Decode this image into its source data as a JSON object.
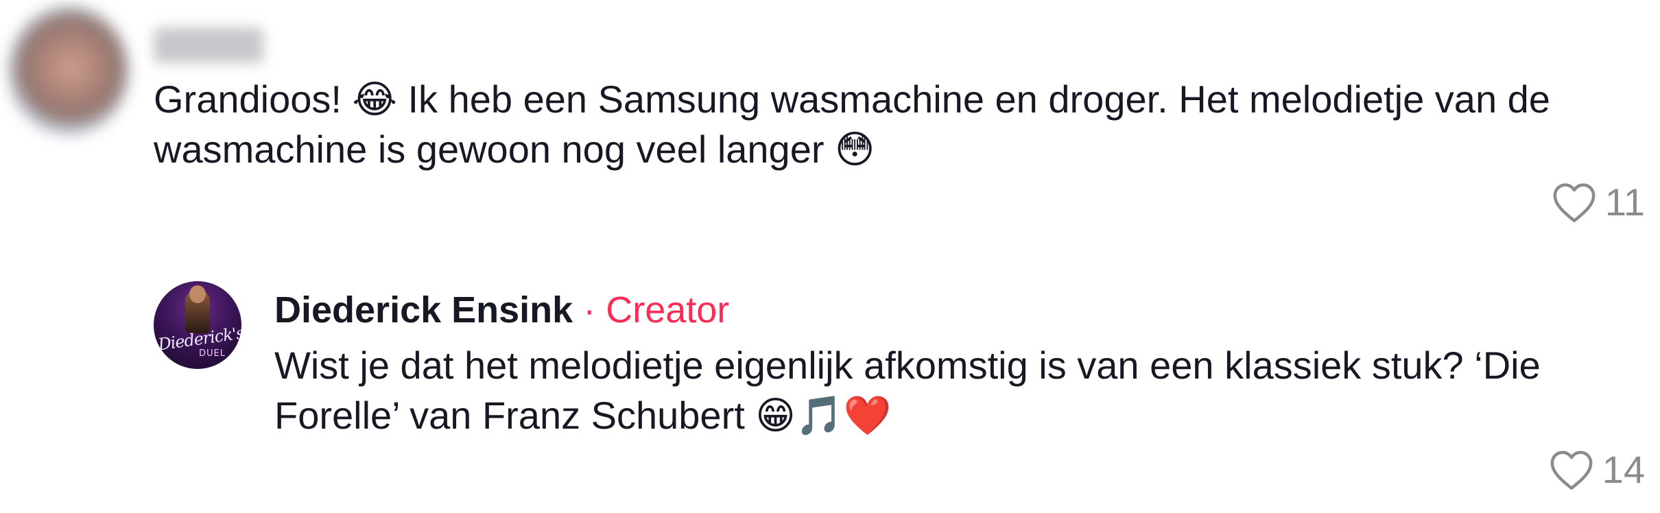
{
  "comment": {
    "username": "",
    "text": "Grandioos! 😂 Ik heb een Samsung wasmachine en droger. Het melodietje van de wasmachine is gewoon nog veel langer 😳",
    "likes": "11",
    "like_icon": "heart-outline-icon"
  },
  "reply": {
    "author": "Diederick Ensink",
    "separator": "·",
    "role": "Creator",
    "text": "Wist je dat het melodietje eigenlijk afkomstig is van een klassiek stuk? ‘Die Forelle’ van Franz Schubert 😁🎵❤️",
    "likes": "14",
    "like_icon": "heart-outline-icon",
    "avatar_logo_text": "Diederick's",
    "avatar_logo_sub": "DUEL"
  },
  "colors": {
    "text": "#161823",
    "creator_accent": "#fe2c55",
    "muted": "#8a8b91",
    "background": "#ffffff"
  }
}
